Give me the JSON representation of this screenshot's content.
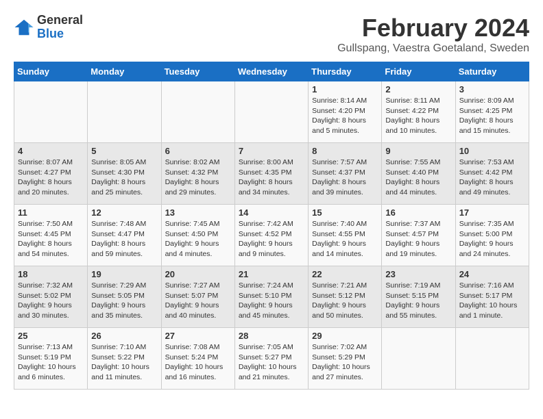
{
  "logo": {
    "general": "General",
    "blue": "Blue"
  },
  "header": {
    "month": "February 2024",
    "location": "Gullspang, Vaestra Goetaland, Sweden"
  },
  "weekdays": [
    "Sunday",
    "Monday",
    "Tuesday",
    "Wednesday",
    "Thursday",
    "Friday",
    "Saturday"
  ],
  "weeks": [
    {
      "days": [
        {
          "num": "",
          "lines": []
        },
        {
          "num": "",
          "lines": []
        },
        {
          "num": "",
          "lines": []
        },
        {
          "num": "",
          "lines": []
        },
        {
          "num": "1",
          "lines": [
            "Sunrise: 8:14 AM",
            "Sunset: 4:20 PM",
            "Daylight: 8 hours",
            "and 5 minutes."
          ]
        },
        {
          "num": "2",
          "lines": [
            "Sunrise: 8:11 AM",
            "Sunset: 4:22 PM",
            "Daylight: 8 hours",
            "and 10 minutes."
          ]
        },
        {
          "num": "3",
          "lines": [
            "Sunrise: 8:09 AM",
            "Sunset: 4:25 PM",
            "Daylight: 8 hours",
            "and 15 minutes."
          ]
        }
      ]
    },
    {
      "days": [
        {
          "num": "4",
          "lines": [
            "Sunrise: 8:07 AM",
            "Sunset: 4:27 PM",
            "Daylight: 8 hours",
            "and 20 minutes."
          ]
        },
        {
          "num": "5",
          "lines": [
            "Sunrise: 8:05 AM",
            "Sunset: 4:30 PM",
            "Daylight: 8 hours",
            "and 25 minutes."
          ]
        },
        {
          "num": "6",
          "lines": [
            "Sunrise: 8:02 AM",
            "Sunset: 4:32 PM",
            "Daylight: 8 hours",
            "and 29 minutes."
          ]
        },
        {
          "num": "7",
          "lines": [
            "Sunrise: 8:00 AM",
            "Sunset: 4:35 PM",
            "Daylight: 8 hours",
            "and 34 minutes."
          ]
        },
        {
          "num": "8",
          "lines": [
            "Sunrise: 7:57 AM",
            "Sunset: 4:37 PM",
            "Daylight: 8 hours",
            "and 39 minutes."
          ]
        },
        {
          "num": "9",
          "lines": [
            "Sunrise: 7:55 AM",
            "Sunset: 4:40 PM",
            "Daylight: 8 hours",
            "and 44 minutes."
          ]
        },
        {
          "num": "10",
          "lines": [
            "Sunrise: 7:53 AM",
            "Sunset: 4:42 PM",
            "Daylight: 8 hours",
            "and 49 minutes."
          ]
        }
      ]
    },
    {
      "days": [
        {
          "num": "11",
          "lines": [
            "Sunrise: 7:50 AM",
            "Sunset: 4:45 PM",
            "Daylight: 8 hours",
            "and 54 minutes."
          ]
        },
        {
          "num": "12",
          "lines": [
            "Sunrise: 7:48 AM",
            "Sunset: 4:47 PM",
            "Daylight: 8 hours",
            "and 59 minutes."
          ]
        },
        {
          "num": "13",
          "lines": [
            "Sunrise: 7:45 AM",
            "Sunset: 4:50 PM",
            "Daylight: 9 hours",
            "and 4 minutes."
          ]
        },
        {
          "num": "14",
          "lines": [
            "Sunrise: 7:42 AM",
            "Sunset: 4:52 PM",
            "Daylight: 9 hours",
            "and 9 minutes."
          ]
        },
        {
          "num": "15",
          "lines": [
            "Sunrise: 7:40 AM",
            "Sunset: 4:55 PM",
            "Daylight: 9 hours",
            "and 14 minutes."
          ]
        },
        {
          "num": "16",
          "lines": [
            "Sunrise: 7:37 AM",
            "Sunset: 4:57 PM",
            "Daylight: 9 hours",
            "and 19 minutes."
          ]
        },
        {
          "num": "17",
          "lines": [
            "Sunrise: 7:35 AM",
            "Sunset: 5:00 PM",
            "Daylight: 9 hours",
            "and 24 minutes."
          ]
        }
      ]
    },
    {
      "days": [
        {
          "num": "18",
          "lines": [
            "Sunrise: 7:32 AM",
            "Sunset: 5:02 PM",
            "Daylight: 9 hours",
            "and 30 minutes."
          ]
        },
        {
          "num": "19",
          "lines": [
            "Sunrise: 7:29 AM",
            "Sunset: 5:05 PM",
            "Daylight: 9 hours",
            "and 35 minutes."
          ]
        },
        {
          "num": "20",
          "lines": [
            "Sunrise: 7:27 AM",
            "Sunset: 5:07 PM",
            "Daylight: 9 hours",
            "and 40 minutes."
          ]
        },
        {
          "num": "21",
          "lines": [
            "Sunrise: 7:24 AM",
            "Sunset: 5:10 PM",
            "Daylight: 9 hours",
            "and 45 minutes."
          ]
        },
        {
          "num": "22",
          "lines": [
            "Sunrise: 7:21 AM",
            "Sunset: 5:12 PM",
            "Daylight: 9 hours",
            "and 50 minutes."
          ]
        },
        {
          "num": "23",
          "lines": [
            "Sunrise: 7:19 AM",
            "Sunset: 5:15 PM",
            "Daylight: 9 hours",
            "and 55 minutes."
          ]
        },
        {
          "num": "24",
          "lines": [
            "Sunrise: 7:16 AM",
            "Sunset: 5:17 PM",
            "Daylight: 10 hours",
            "and 1 minute."
          ]
        }
      ]
    },
    {
      "days": [
        {
          "num": "25",
          "lines": [
            "Sunrise: 7:13 AM",
            "Sunset: 5:19 PM",
            "Daylight: 10 hours",
            "and 6 minutes."
          ]
        },
        {
          "num": "26",
          "lines": [
            "Sunrise: 7:10 AM",
            "Sunset: 5:22 PM",
            "Daylight: 10 hours",
            "and 11 minutes."
          ]
        },
        {
          "num": "27",
          "lines": [
            "Sunrise: 7:08 AM",
            "Sunset: 5:24 PM",
            "Daylight: 10 hours",
            "and 16 minutes."
          ]
        },
        {
          "num": "28",
          "lines": [
            "Sunrise: 7:05 AM",
            "Sunset: 5:27 PM",
            "Daylight: 10 hours",
            "and 21 minutes."
          ]
        },
        {
          "num": "29",
          "lines": [
            "Sunrise: 7:02 AM",
            "Sunset: 5:29 PM",
            "Daylight: 10 hours",
            "and 27 minutes."
          ]
        },
        {
          "num": "",
          "lines": []
        },
        {
          "num": "",
          "lines": []
        }
      ]
    }
  ]
}
